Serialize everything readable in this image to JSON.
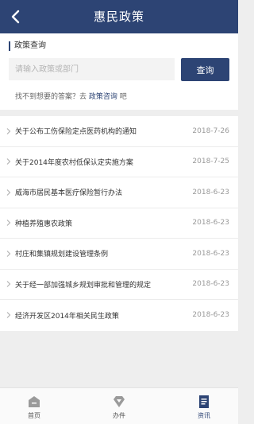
{
  "header": {
    "title": "惠民政策"
  },
  "query": {
    "section_title": "政策查询",
    "placeholder": "请输入政策或部门",
    "button_label": "查询",
    "hint_prefix": "找不到想要的答案？去",
    "hint_link": "政策咨询",
    "hint_suffix": "吧"
  },
  "policies": [
    {
      "title": "关于公布工伤保险定点医药机构的通知",
      "date": "2018-7-26"
    },
    {
      "title": "关于2014年度农村低保认定实施方案",
      "date": "2018-7-25"
    },
    {
      "title": "威海市居民基本医疗保险暂行办法",
      "date": "2018-6-23"
    },
    {
      "title": "种植养殖惠农政策",
      "date": "2018-6-23"
    },
    {
      "title": "村庄和集镇规划建设管理条例",
      "date": "2018-6-23"
    },
    {
      "title": "关于经一部加强城乡规划审批和管理的规定",
      "date": "2018-6-23"
    },
    {
      "title": "经济开发区2014年相关民生政策",
      "date": "2018-6-23"
    }
  ],
  "tabs": [
    {
      "label": "首页",
      "icon": "home-icon"
    },
    {
      "label": "办件",
      "icon": "diamond-icon"
    },
    {
      "label": "资讯",
      "icon": "news-icon"
    }
  ],
  "colors": {
    "brand": "#2d4474"
  }
}
